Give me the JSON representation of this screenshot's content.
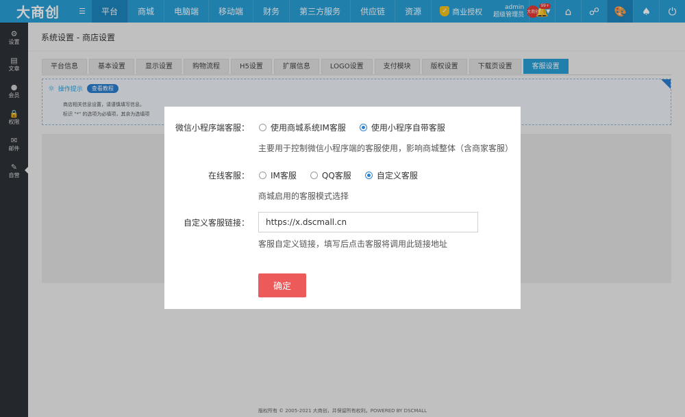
{
  "brand": {
    "logo": "大商创",
    "logo_sub": "☰"
  },
  "nav": [
    {
      "label": "平台",
      "active": true
    },
    {
      "label": "商城"
    },
    {
      "label": "电脑端"
    },
    {
      "label": "移动端"
    },
    {
      "label": "财务"
    },
    {
      "label": "第三方服务"
    },
    {
      "label": "供应链"
    },
    {
      "label": "资源"
    }
  ],
  "auth": {
    "label": "商业授权"
  },
  "user": {
    "name": "admin",
    "role": "超级管理员",
    "avatar_text": "大商创"
  },
  "top_icons": [
    {
      "name": "bell-icon",
      "glyph": "🔔",
      "badge": "99+"
    },
    {
      "name": "home-icon",
      "glyph": "⌂"
    },
    {
      "name": "sitemap-icon",
      "glyph": "☍"
    },
    {
      "name": "palette-icon",
      "glyph": "🎨",
      "active": true
    },
    {
      "name": "broom-icon",
      "glyph": "♠"
    },
    {
      "name": "power-icon",
      "glyph": "⏻"
    }
  ],
  "sidebar": [
    {
      "label": "设置",
      "glyph": "⚙"
    },
    {
      "label": "文章",
      "glyph": "▤"
    },
    {
      "label": "会员",
      "glyph": "●"
    },
    {
      "label": "权限",
      "glyph": "🔒"
    },
    {
      "label": "邮件",
      "glyph": "✉"
    },
    {
      "label": "自营",
      "glyph": "✎",
      "active": true
    }
  ],
  "page": {
    "title": "系统设置 - 商店设置"
  },
  "tabs": [
    "平台信息",
    "基本设置",
    "显示设置",
    "购物流程",
    "H5设置",
    "扩展信息",
    "LOGO设置",
    "支付模块",
    "版权设置",
    "下载页设置",
    "客服设置"
  ],
  "active_tab": "客服设置",
  "tips": {
    "title": "操作提示",
    "button": "查看教程",
    "lines": [
      "商店相关信息设置，请谨慎填写信息。",
      "标识 \"*\" 的选项为必填项，其余为选填项"
    ]
  },
  "modal": {
    "mini_label": "微信小程序端客服：",
    "mini_options": [
      "使用商城系统IM客服",
      "使用小程序自带客服"
    ],
    "mini_selected": 1,
    "mini_hint": "主要用于控制微信小程序端的客服使用，影响商城整体（含商家客服）",
    "online_label": "在线客服：",
    "online_options": [
      "IM客服",
      "QQ客服",
      "自定义客服"
    ],
    "online_selected": 2,
    "online_hint": "商城启用的客服模式选择",
    "link_label": "自定义客服链接：",
    "link_value": "https://x.dscmall.cn",
    "link_hint": "客服自定义链接，填写后点击客服将调用此链接地址",
    "confirm": "确定"
  },
  "footer": "版权所有 © 2005-2021 大商创，并保留所有权利。POWERED BY DSCMALL",
  "colors": {
    "primary": "#2a9fd8",
    "sidebar": "#2d3136",
    "confirm": "#ec5a5a",
    "radio": "#2a7fd0"
  }
}
